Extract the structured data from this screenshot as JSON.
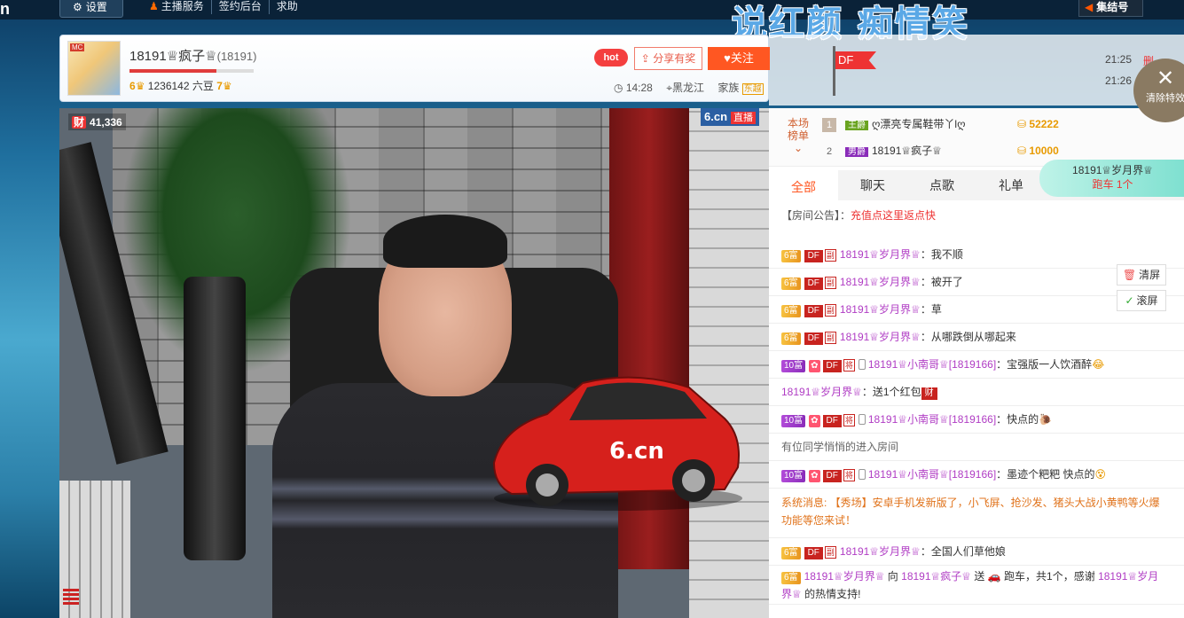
{
  "topbar": {
    "logo": "n",
    "settings_label": "设置",
    "nav": [
      "主播服务",
      "签约后台",
      "求助"
    ],
    "slogan": "说红颜 痴情笑",
    "jiejie_label": "集结号"
  },
  "anchor": {
    "name": "18191♕疯子♕",
    "room_id": "(18191)",
    "exp_progress": 0.7,
    "level_left": "6",
    "beans": "1236142 六豆",
    "level_right": "7",
    "hot_label": "hot",
    "share_label": "分享有奖",
    "follow_label": "关注",
    "time": "14:28",
    "location": "黑龙江",
    "family_label": "家族",
    "family_tag": "东越"
  },
  "df_flag": "DF",
  "timestamps": [
    "21:25",
    "21:26"
  ],
  "ts_extra": "删",
  "clear_fx_label": "清除特效",
  "video": {
    "viewer_count": "41,336",
    "cai": "财",
    "brand": "6.cn",
    "live": "直播"
  },
  "rank": {
    "label_line1": "本场",
    "label_line2": "榜单",
    "rows": [
      {
        "num": "1",
        "badge": "王爵",
        "name": "ღ漂亮专属鞋带丫lღ",
        "coins": "52222"
      },
      {
        "num": "2",
        "badge": "男爵",
        "name": "18191♕疯子♕",
        "coins": "10000"
      }
    ]
  },
  "race": {
    "user": "18191♕岁月界♕",
    "car": "跑车",
    "count": "1个"
  },
  "tabs": [
    "全部",
    "聊天",
    "点歌",
    "礼单"
  ],
  "notice": {
    "label": "【房间公告】",
    "sep": "：",
    "link": "充值点这里返点快"
  },
  "messages": [
    {
      "lv": "6富",
      "user": "18191♕岁月界♕",
      "text": "我不顺"
    },
    {
      "lv": "6富",
      "user": "18191♕岁月界♕",
      "text": "被开了"
    },
    {
      "lv": "6富",
      "user": "18191♕岁月界♕",
      "text": "草"
    },
    {
      "lv": "6富",
      "user": "18191♕岁月界♕",
      "text": "从哪跌倒从哪起来"
    },
    {
      "lv": "10富",
      "user": "18191♕小南哥♕",
      "uid": "[1819166]",
      "text": "宝强版一人饮酒醉"
    },
    {
      "redpack_user": "18191♕岁月界♕",
      "redpack_text": "送1个红包"
    },
    {
      "lv": "10富",
      "user": "18191♕小南哥♕",
      "uid": "[1819166]",
      "text": "快点的"
    },
    {
      "grey": "有位同学悄悄的进入房间"
    },
    {
      "lv": "10富",
      "user": "18191♕小南哥♕",
      "uid": "[1819166]",
      "text": "墨迹个粑粑 快点的"
    },
    {
      "sys": "系统消息: 【秀场】安卓手机发新版了，小飞屏、抢沙发、猪头大战小黄鸭等火爆功能等您来试！"
    },
    {
      "lv": "6富",
      "user": "18191♕岁月界♕",
      "text": "全国人们草他娘"
    },
    {
      "gift_from": "18191♕岁月界♕",
      "gift_to": "18191♕疯子♕",
      "gift_text": "跑车，共1个，感谢",
      "gift_thanks": "18191♕岁月界♕",
      "gift_tail": "的热情支持!"
    }
  ],
  "side_buttons": {
    "clear": "清屏",
    "scroll": "滚屏"
  },
  "badges": {
    "df": "DF",
    "fu": "副",
    "jiang": "将",
    "colon": "：",
    "to": "向",
    "send": "送"
  }
}
